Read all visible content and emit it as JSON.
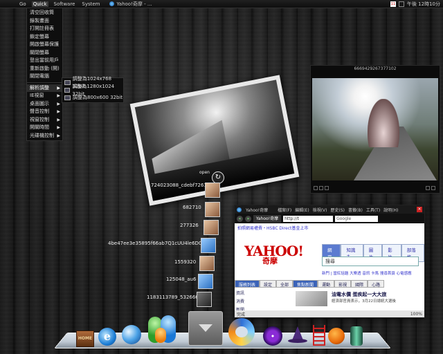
{
  "topbar": {
    "menus": [
      "Go",
      "Quick",
      "Software",
      "System"
    ],
    "active_menu": "Quick",
    "task_title": "Yahoo!奇摩 - ...",
    "calendar_day": "11",
    "clock": "午後 12時10分"
  },
  "quick_menu": {
    "items": [
      "清空回收筒",
      "錄製畫面",
      "打開註冊表",
      "鎖定螢幕",
      "開啟螢幕保護",
      "關閉螢幕",
      "登出當前用戶",
      "重新啟動 (開)",
      "關閉電腦"
    ],
    "sub_items": [
      "解析調整",
      "IE視窗",
      "桌面圖示",
      "聲音控制",
      "視窗控制",
      "開關時間",
      "光碟機控制"
    ],
    "highlighted": "解析調整"
  },
  "resolution_submenu": {
    "items": [
      "調整為1024x768 32bit",
      "調整為1280x1024 32bit",
      "調整為800x600 32bit"
    ]
  },
  "photo_viewer": {
    "caption": "6669429267377102"
  },
  "photo_stack": {
    "open_label": "open",
    "items": [
      "724023088_cdebf7261e",
      "682710",
      "277326",
      "4be47ee3e35895f66ab7Q1cUU4le6DCC",
      "1559320",
      "125048_au6",
      "1183113789_532666"
    ]
  },
  "browser": {
    "title": "Yahoo!奇摩",
    "menus": [
      "檔案(F)",
      "編輯(E)",
      "檢視(V)",
      "歷史(S)",
      "書籤(B)",
      "工具(T)",
      "說明(H)"
    ],
    "tab_label": "Yahoo!奇摩",
    "url": "http://t",
    "search_placeholder": "Google",
    "status": "完成",
    "zoom": "100%",
    "page": {
      "promo": "拍照網易權費・HSBC Direct基金上市",
      "logo": "YAHOO!",
      "logo_sub": "奇摩",
      "search_tabs": [
        "網頁",
        "知識+",
        "圖片",
        "影片",
        "部落格"
      ],
      "search_label": "搜尋",
      "links": "新門 | 當紅話題 大樂透 音訊 卡馬 搜尋首頁 心電感應",
      "section_tabs": [
        "服務列表",
        "設定",
        "全部",
        "焦點新聞",
        "運動",
        "影視",
        "國際",
        "心路"
      ],
      "left_items": [
        "資訊",
        "消費",
        "新聞",
        "拍賣"
      ],
      "news_title": "油電水價 蛋疾起一大大旅",
      "news_desc": "經濟部官員表示，3月22日總統大選後"
    }
  },
  "dock": {
    "home_label": "HOME",
    "ie_letter": "e"
  }
}
